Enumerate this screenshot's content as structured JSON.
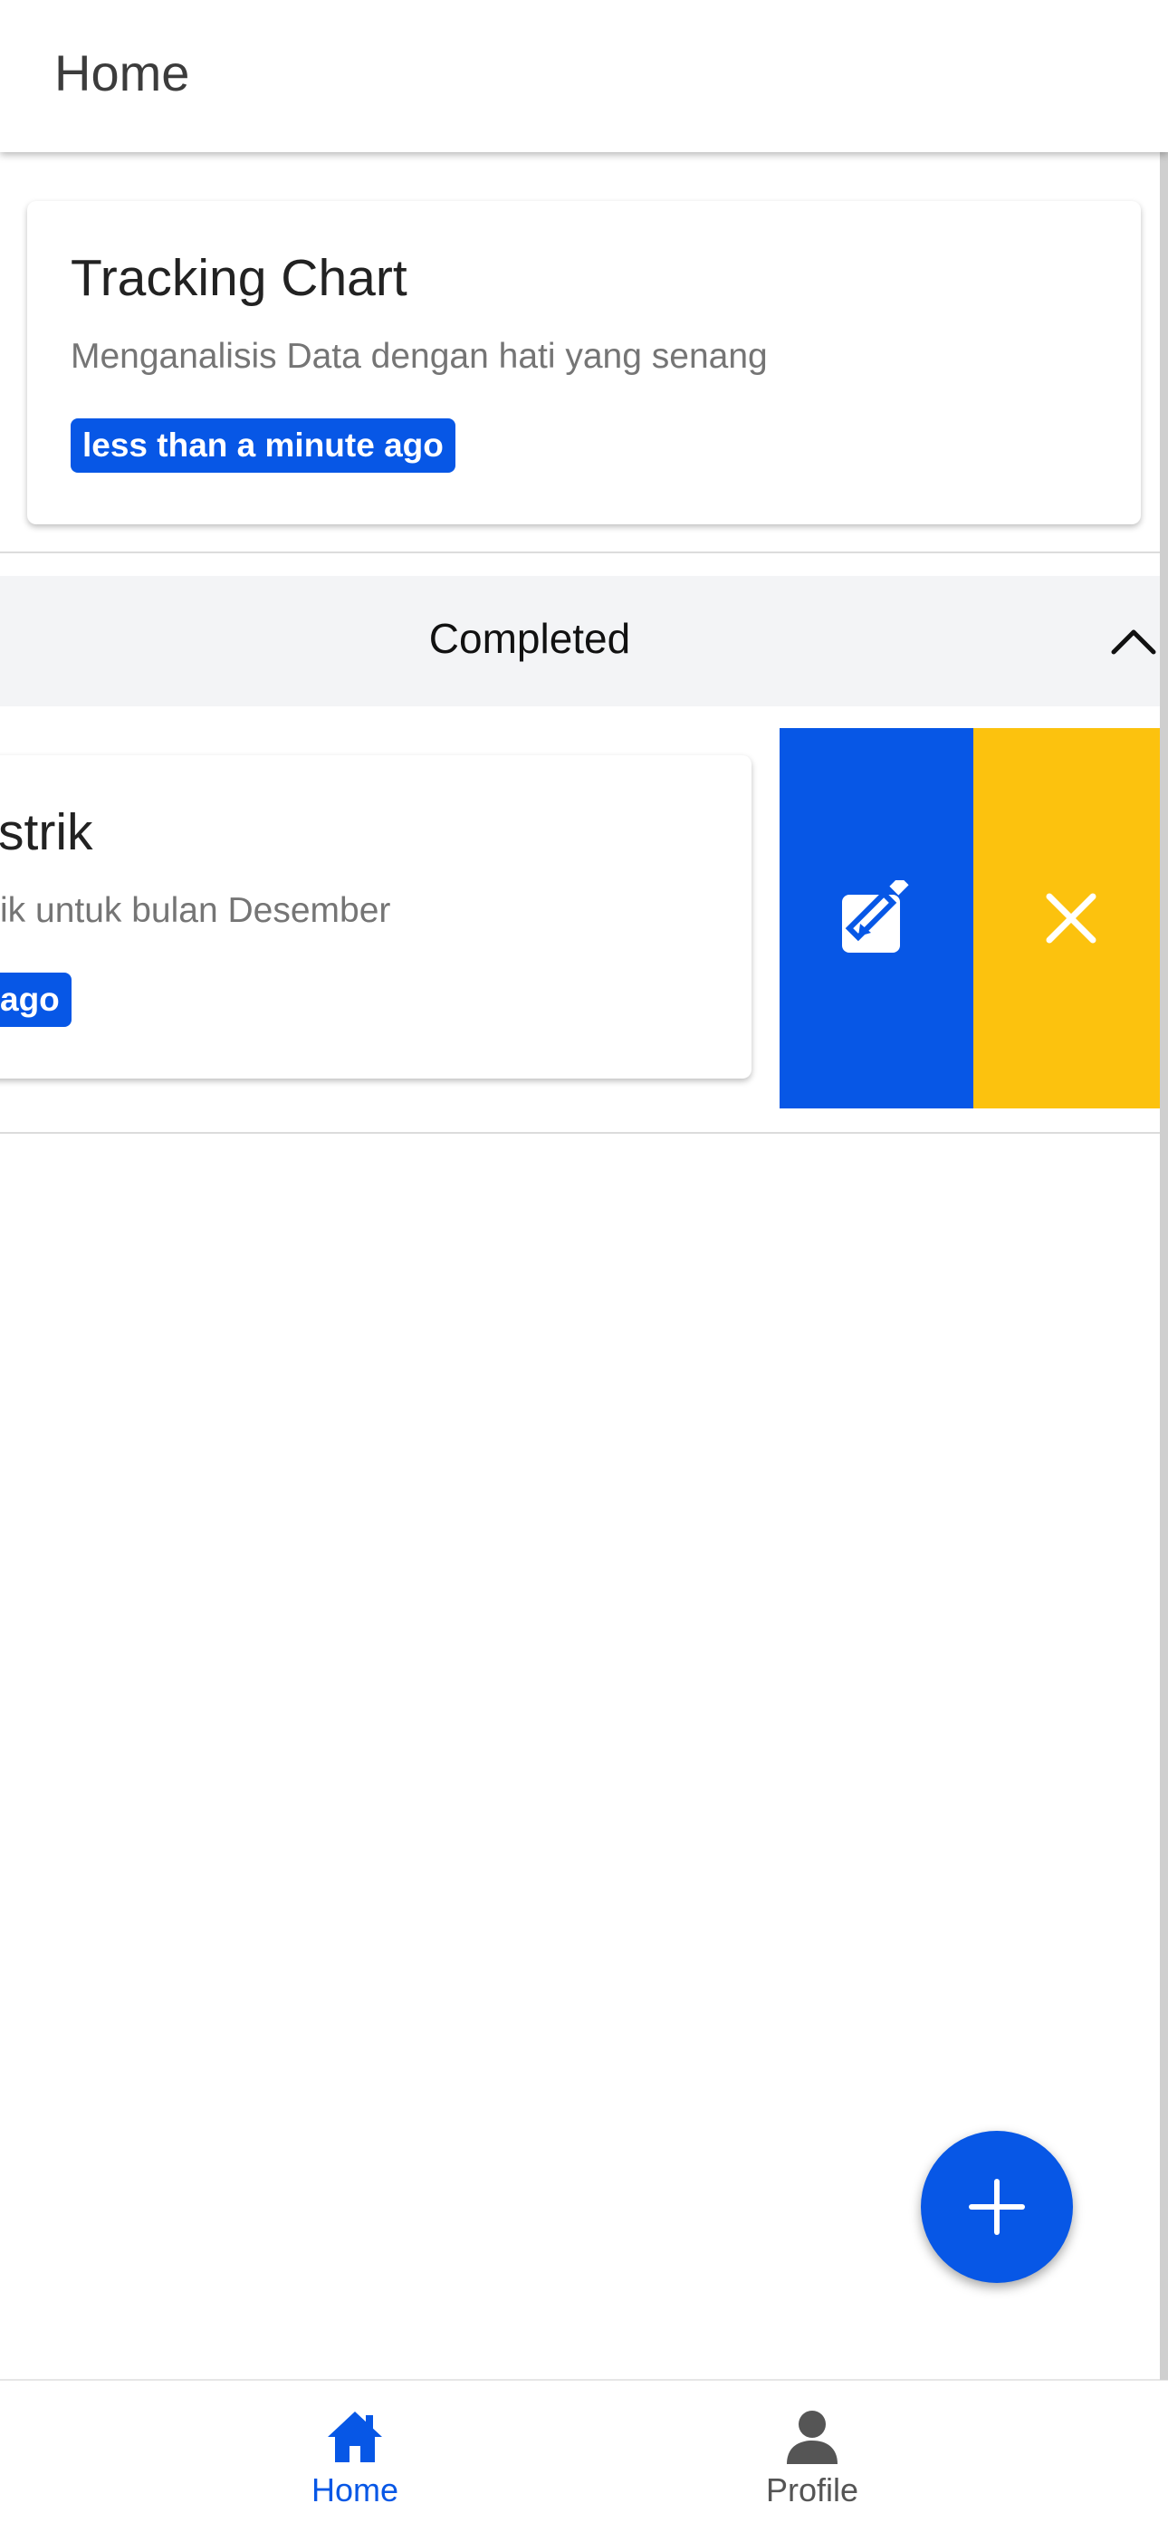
{
  "app_bar": {
    "title": "Home"
  },
  "tasks": [
    {
      "title": "Tracking Chart",
      "subtitle": "Menganalisis Data dengan hati yang senang",
      "time": "less than a minute ago"
    }
  ],
  "completed_section": {
    "title": "Completed",
    "expanded": true,
    "items": [
      {
        "title": "strik",
        "subtitle": "ik untuk bulan Desember",
        "time": "ago"
      }
    ]
  },
  "swipe_actions": {
    "edit_icon": "edit-icon",
    "delete_icon": "close-icon"
  },
  "fab": {
    "icon": "plus-icon"
  },
  "bottom_nav": {
    "items": [
      {
        "label": "Home",
        "icon": "home-icon",
        "active": true
      },
      {
        "label": "Profile",
        "icon": "person-icon",
        "active": false
      }
    ]
  },
  "colors": {
    "primary": "#0757e6",
    "warning": "#fcc20e",
    "section_bg": "#f3f4f6",
    "inactive": "#555555"
  }
}
